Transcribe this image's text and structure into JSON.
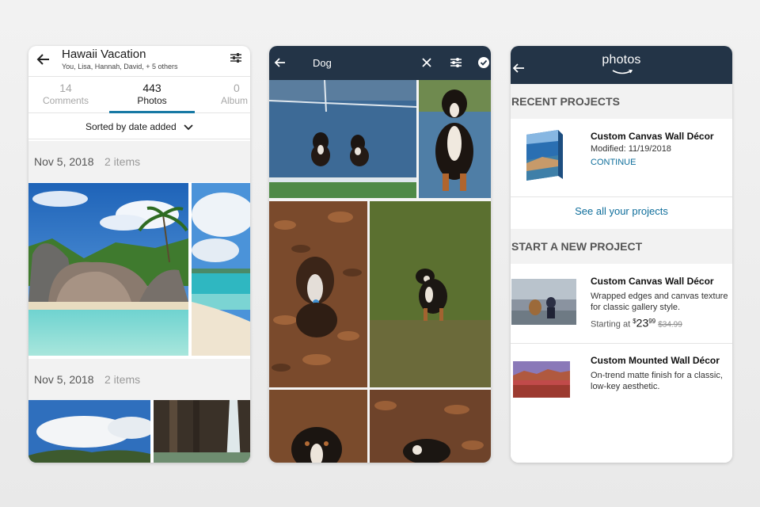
{
  "screen1": {
    "title": "Hawaii Vacation",
    "subtitle": "You, Lisa, Hannah, David, + 5 others",
    "tabs": [
      {
        "count": "14",
        "label": "Comments"
      },
      {
        "count": "443",
        "label": "Photos"
      },
      {
        "count": "0",
        "label": "Album"
      }
    ],
    "sort_label": "Sorted by date added",
    "groups": [
      {
        "date": "Nov 5, 2018",
        "count": "2 items"
      },
      {
        "date": "Nov 5, 2018",
        "count": "2 items"
      }
    ]
  },
  "screen2": {
    "search_query": "Dog"
  },
  "screen3": {
    "logo": "photos",
    "recent_heading": "RECENT PROJECTS",
    "recent_project": {
      "title": "Custom Canvas Wall Décor",
      "modified": "Modified: 11/19/2018",
      "action": "CONTINUE"
    },
    "see_all": "See all your projects",
    "new_heading": "START A NEW PROJECT",
    "products": [
      {
        "title": "Custom Canvas Wall Décor",
        "line1": "Wrapped edges and canvas texture",
        "line2": "for classic gallery style.",
        "price_prefix": "Starting at",
        "price_symbol": "$",
        "price_whole": "23",
        "price_cents": "99",
        "list_price": "$34.99"
      },
      {
        "title": "Custom Mounted Wall Décor",
        "line1": "On-trend matte finish for a classic,",
        "line2": "low-key aesthetic."
      }
    ]
  },
  "colors": {
    "navy_bar": "#233447",
    "accent_blue": "#1779a4",
    "link_blue": "#0f6e9b"
  }
}
